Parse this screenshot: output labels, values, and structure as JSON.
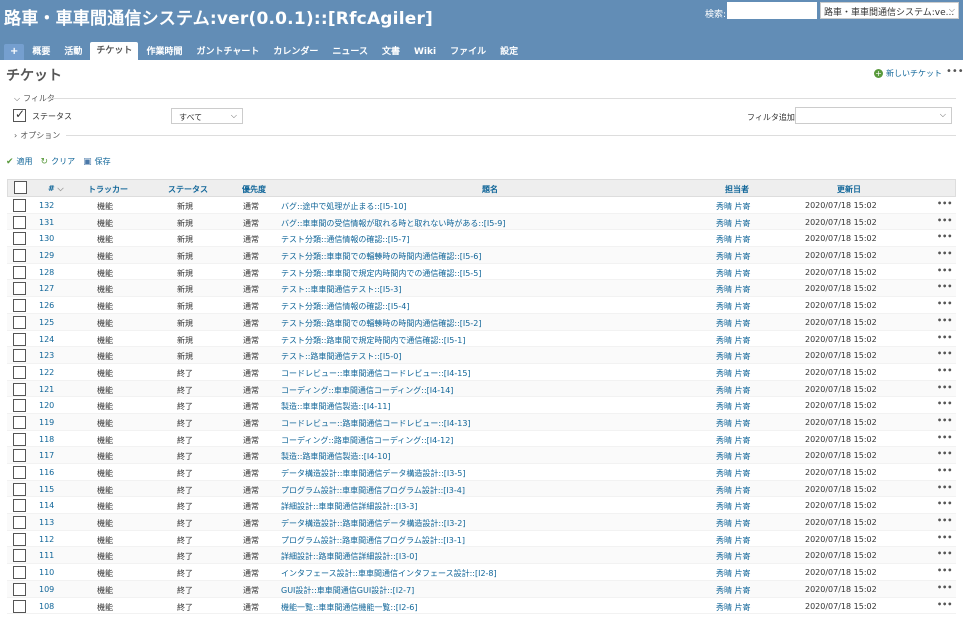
{
  "header": {
    "title": "路車・車車間通信システム:ver(0.0.1)::[RfcAgiler]",
    "search_label": "検索:",
    "search_value": "",
    "project_select": "路車・車車間通信システム:ve...",
    "color": "#628db6"
  },
  "tabs": [
    {
      "label": "+"
    },
    {
      "label": "概要"
    },
    {
      "label": "活動"
    },
    {
      "label": "チケット"
    },
    {
      "label": "作業時間"
    },
    {
      "label": "ガントチャート"
    },
    {
      "label": "カレンダー"
    },
    {
      "label": "ニュース"
    },
    {
      "label": "文書"
    },
    {
      "label": "Wiki"
    },
    {
      "label": "ファイル"
    },
    {
      "label": "設定"
    }
  ],
  "page": {
    "title": "チケット",
    "new_ticket": "新しいチケット",
    "more": "•••"
  },
  "filter": {
    "legend": "フィルタ",
    "status_label": "ステータス",
    "status_value": "すべて",
    "add_filter_label": "フィルタ追加",
    "add_filter_value": "",
    "options_legend": "オプション"
  },
  "actions": {
    "apply": "適用",
    "clear": "クリア",
    "save": "保存"
  },
  "table": {
    "headers": {
      "id": "#",
      "tracker": "トラッカー",
      "status": "ステータス",
      "priority": "優先度",
      "subject": "題名",
      "assignee": "担当者",
      "updated": "更新日"
    },
    "rows": [
      {
        "id": "132",
        "tracker": "機能",
        "status": "新規",
        "priority": "通常",
        "subject": "バグ::途中で処理が止まる::[I5-10]",
        "assignee": "秀晴 片寄",
        "updated": "2020/07/18 15:02"
      },
      {
        "id": "131",
        "tracker": "機能",
        "status": "新規",
        "priority": "通常",
        "subject": "バグ::車車間の受信情報が取れる時と取れない時がある::[I5-9]",
        "assignee": "秀晴 片寄",
        "updated": "2020/07/18 15:02"
      },
      {
        "id": "130",
        "tracker": "機能",
        "status": "新規",
        "priority": "通常",
        "subject": "テスト分類::通信情報の確認::[I5-7]",
        "assignee": "秀晴 片寄",
        "updated": "2020/07/18 15:02"
      },
      {
        "id": "129",
        "tracker": "機能",
        "status": "新規",
        "priority": "通常",
        "subject": "テスト分類::車車間での輻輳時の時間内通信確認::[I5-6]",
        "assignee": "秀晴 片寄",
        "updated": "2020/07/18 15:02"
      },
      {
        "id": "128",
        "tracker": "機能",
        "status": "新規",
        "priority": "通常",
        "subject": "テスト分類::車車間で規定内時間内での通信確認::[I5-5]",
        "assignee": "秀晴 片寄",
        "updated": "2020/07/18 15:02"
      },
      {
        "id": "127",
        "tracker": "機能",
        "status": "新規",
        "priority": "通常",
        "subject": "テスト::車車間通信テスト::[I5-3]",
        "assignee": "秀晴 片寄",
        "updated": "2020/07/18 15:02"
      },
      {
        "id": "126",
        "tracker": "機能",
        "status": "新規",
        "priority": "通常",
        "subject": "テスト分類::通信情報の確認::[I5-4]",
        "assignee": "秀晴 片寄",
        "updated": "2020/07/18 15:02"
      },
      {
        "id": "125",
        "tracker": "機能",
        "status": "新規",
        "priority": "通常",
        "subject": "テスト分類::路車間での輻輳時の時間内通信確認::[I5-2]",
        "assignee": "秀晴 片寄",
        "updated": "2020/07/18 15:02"
      },
      {
        "id": "124",
        "tracker": "機能",
        "status": "新規",
        "priority": "通常",
        "subject": "テスト分類::路車間で規定時間内で通信確認::[I5-1]",
        "assignee": "秀晴 片寄",
        "updated": "2020/07/18 15:02"
      },
      {
        "id": "123",
        "tracker": "機能",
        "status": "新規",
        "priority": "通常",
        "subject": "テスト::路車間通信テスト::[I5-0]",
        "assignee": "秀晴 片寄",
        "updated": "2020/07/18 15:02"
      },
      {
        "id": "122",
        "tracker": "機能",
        "status": "終了",
        "priority": "通常",
        "subject": "コードレビュー::車車間通信コードレビュー::[I4-15]",
        "assignee": "秀晴 片寄",
        "updated": "2020/07/18 15:02"
      },
      {
        "id": "121",
        "tracker": "機能",
        "status": "終了",
        "priority": "通常",
        "subject": "コーディング::車車間通信コーディング::[I4-14]",
        "assignee": "秀晴 片寄",
        "updated": "2020/07/18 15:02"
      },
      {
        "id": "120",
        "tracker": "機能",
        "status": "終了",
        "priority": "通常",
        "subject": "製造::車車間通信製造::[I4-11]",
        "assignee": "秀晴 片寄",
        "updated": "2020/07/18 15:02"
      },
      {
        "id": "119",
        "tracker": "機能",
        "status": "終了",
        "priority": "通常",
        "subject": "コードレビュー::路車間通信コードレビュー::[I4-13]",
        "assignee": "秀晴 片寄",
        "updated": "2020/07/18 15:02"
      },
      {
        "id": "118",
        "tracker": "機能",
        "status": "終了",
        "priority": "通常",
        "subject": "コーディング::路車間通信コーディング::[I4-12]",
        "assignee": "秀晴 片寄",
        "updated": "2020/07/18 15:02"
      },
      {
        "id": "117",
        "tracker": "機能",
        "status": "終了",
        "priority": "通常",
        "subject": "製造::路車間通信製造::[I4-10]",
        "assignee": "秀晴 片寄",
        "updated": "2020/07/18 15:02"
      },
      {
        "id": "116",
        "tracker": "機能",
        "status": "終了",
        "priority": "通常",
        "subject": "データ構造設計::車車間通信データ構造設計::[I3-5]",
        "assignee": "秀晴 片寄",
        "updated": "2020/07/18 15:02"
      },
      {
        "id": "115",
        "tracker": "機能",
        "status": "終了",
        "priority": "通常",
        "subject": "プログラム設計::車車間通信プログラム設計::[I3-4]",
        "assignee": "秀晴 片寄",
        "updated": "2020/07/18 15:02"
      },
      {
        "id": "114",
        "tracker": "機能",
        "status": "終了",
        "priority": "通常",
        "subject": "詳細設計::車車間通信詳細設計::[I3-3]",
        "assignee": "秀晴 片寄",
        "updated": "2020/07/18 15:02"
      },
      {
        "id": "113",
        "tracker": "機能",
        "status": "終了",
        "priority": "通常",
        "subject": "データ構造設計::路車間通信データ構造設計::[I3-2]",
        "assignee": "秀晴 片寄",
        "updated": "2020/07/18 15:02"
      },
      {
        "id": "112",
        "tracker": "機能",
        "status": "終了",
        "priority": "通常",
        "subject": "プログラム設計::路車間通信プログラム設計::[I3-1]",
        "assignee": "秀晴 片寄",
        "updated": "2020/07/18 15:02"
      },
      {
        "id": "111",
        "tracker": "機能",
        "status": "終了",
        "priority": "通常",
        "subject": "詳細設計::路車間通信詳細設計::[I3-0]",
        "assignee": "秀晴 片寄",
        "updated": "2020/07/18 15:02"
      },
      {
        "id": "110",
        "tracker": "機能",
        "status": "終了",
        "priority": "通常",
        "subject": "インタフェース設計::車車間通信インタフェース設計::[I2-8]",
        "assignee": "秀晴 片寄",
        "updated": "2020/07/18 15:02"
      },
      {
        "id": "109",
        "tracker": "機能",
        "status": "終了",
        "priority": "通常",
        "subject": "GUI設計::車車間通信GUI設計::[I2-7]",
        "assignee": "秀晴 片寄",
        "updated": "2020/07/18 15:02"
      },
      {
        "id": "108",
        "tracker": "機能",
        "status": "終了",
        "priority": "通常",
        "subject": "機能一覧::車車間通信機能一覧::[I2-6]",
        "assignee": "秀晴 片寄",
        "updated": "2020/07/18 15:02"
      }
    ],
    "row_more": "•••"
  },
  "colors": {
    "header": "#628db6",
    "link": "#116699",
    "apply_check": "#5a9a3d"
  }
}
